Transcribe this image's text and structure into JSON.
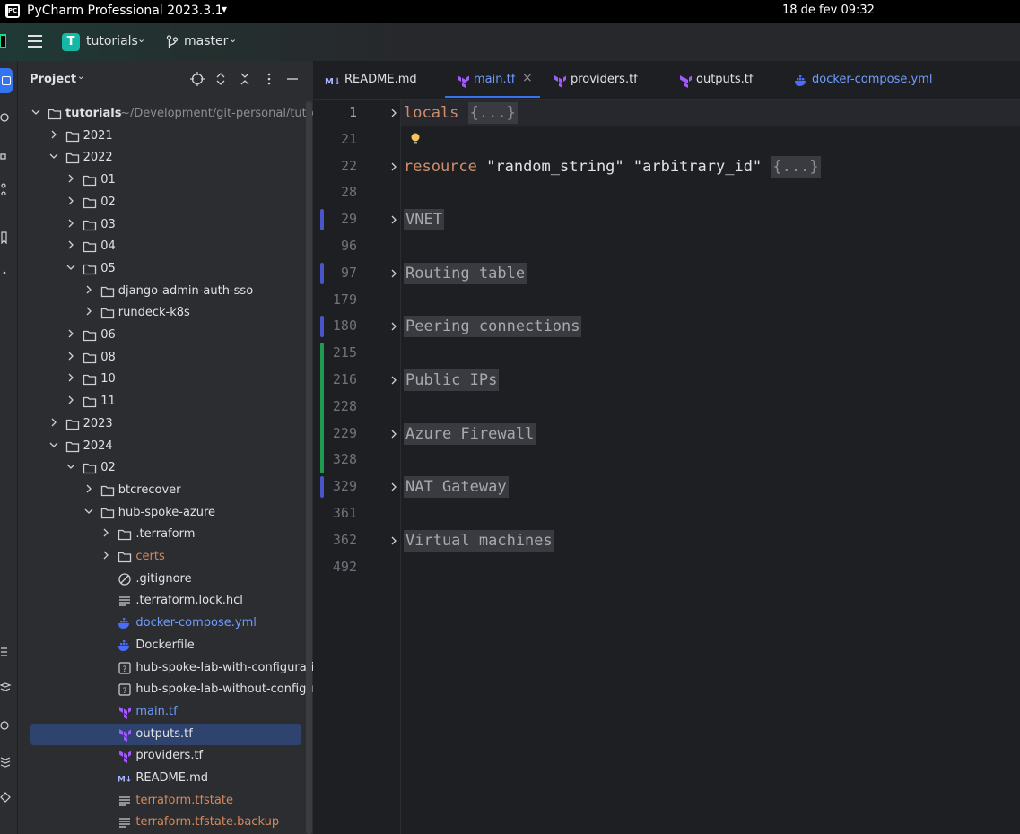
{
  "os_bar": {
    "app_name": "PyCharm Professional 2023.3.1",
    "caret": "▾",
    "date_time": "18 de fev  09:32"
  },
  "header": {
    "project_badge": "T",
    "project_name": "tutorials",
    "branch_name": "master",
    "caret": "⌄"
  },
  "panel": {
    "title": "Project",
    "title_caret": "⌄",
    "tools": [
      "crosshair-icon",
      "expand-icon",
      "collapse-icon",
      "more-icon",
      "minimize-icon"
    ],
    "tree": [
      {
        "label": "tutorials",
        "sub": "~/Development/git-personal/tutorials",
        "type": "folder",
        "depth": 0,
        "open": true,
        "bold": true
      },
      {
        "label": "2021",
        "type": "folder",
        "depth": 1,
        "open": false
      },
      {
        "label": "2022",
        "type": "folder",
        "depth": 1,
        "open": true
      },
      {
        "label": "01",
        "type": "folder",
        "depth": 2,
        "open": false
      },
      {
        "label": "02",
        "type": "folder",
        "depth": 2,
        "open": false
      },
      {
        "label": "03",
        "type": "folder",
        "depth": 2,
        "open": false
      },
      {
        "label": "04",
        "type": "folder",
        "depth": 2,
        "open": false
      },
      {
        "label": "05",
        "type": "folder",
        "depth": 2,
        "open": true
      },
      {
        "label": "django-admin-auth-sso",
        "type": "folder",
        "depth": 3,
        "open": false
      },
      {
        "label": "rundeck-k8s",
        "type": "folder",
        "depth": 3,
        "open": false
      },
      {
        "label": "06",
        "type": "folder",
        "depth": 2,
        "open": false
      },
      {
        "label": "08",
        "type": "folder",
        "depth": 2,
        "open": false
      },
      {
        "label": "10",
        "type": "folder",
        "depth": 2,
        "open": false
      },
      {
        "label": "11",
        "type": "folder",
        "depth": 2,
        "open": false
      },
      {
        "label": "2023",
        "type": "folder",
        "depth": 1,
        "open": false
      },
      {
        "label": "2024",
        "type": "folder",
        "depth": 1,
        "open": true
      },
      {
        "label": "02",
        "type": "folder",
        "depth": 2,
        "open": true
      },
      {
        "label": "btcrecover",
        "type": "folder",
        "depth": 3,
        "open": false
      },
      {
        "label": "hub-spoke-azure",
        "type": "folder",
        "depth": 3,
        "open": true
      },
      {
        "label": ".terraform",
        "type": "folder",
        "depth": 4,
        "open": false
      },
      {
        "label": "certs",
        "type": "folder",
        "depth": 4,
        "open": false,
        "color": "#d5895b"
      },
      {
        "label": ".gitignore",
        "type": "ignore",
        "depth": 4
      },
      {
        "label": ".terraform.lock.hcl",
        "type": "text",
        "depth": 4
      },
      {
        "label": "docker-compose.yml",
        "type": "docker",
        "depth": 4,
        "color": "#6f9cff"
      },
      {
        "label": "Dockerfile",
        "type": "docker",
        "depth": 4
      },
      {
        "label": "hub-spoke-lab-with-configuration",
        "type": "unknown",
        "depth": 4
      },
      {
        "label": "hub-spoke-lab-without-configuration",
        "type": "unknown",
        "depth": 4
      },
      {
        "label": "main.tf",
        "type": "terraform",
        "depth": 4,
        "color": "#6f9cff"
      },
      {
        "label": "outputs.tf",
        "type": "terraform",
        "depth": 4,
        "selected": true
      },
      {
        "label": "providers.tf",
        "type": "terraform",
        "depth": 4
      },
      {
        "label": "README.md",
        "type": "markdown",
        "depth": 4
      },
      {
        "label": "terraform.tfstate",
        "type": "text",
        "depth": 4,
        "color": "#d5895b"
      },
      {
        "label": "terraform.tfstate.backup",
        "type": "text",
        "depth": 4,
        "color": "#d5895b"
      }
    ]
  },
  "tabs": [
    {
      "label": "README.md",
      "icon": "markdown",
      "active": false,
      "color": "#dfe1e5"
    },
    {
      "label": "main.tf",
      "icon": "terraform",
      "active": true,
      "color": "#6f9cff",
      "close": "×"
    },
    {
      "label": "providers.tf",
      "icon": "terraform",
      "active": false,
      "color": "#dfe1e5"
    },
    {
      "label": "outputs.tf",
      "icon": "terraform",
      "active": false,
      "color": "#dfe1e5"
    },
    {
      "label": "docker-compose.yml",
      "icon": "docker",
      "active": false,
      "color": "#6f9cff"
    }
  ],
  "editor": {
    "lines": [
      {
        "num": "1",
        "fold": true,
        "parts": [
          {
            "t": "locals",
            "c": "kw"
          },
          {
            "t": " ",
            "c": ""
          },
          {
            "t": "{...}",
            "c": "fold-box"
          }
        ],
        "current": true
      },
      {
        "num": "21",
        "fold": false,
        "parts": []
      },
      {
        "num": "22",
        "fold": true,
        "parts": [
          {
            "t": "resource",
            "c": "kw"
          },
          {
            "t": " \"random_string\" \"arbitrary_id\" ",
            "c": "str"
          },
          {
            "t": "{...}",
            "c": "fold-box"
          }
        ]
      },
      {
        "num": "28",
        "fold": false,
        "parts": []
      },
      {
        "num": "29",
        "fold": true,
        "parts": [
          {
            "t": "VNET",
            "c": "region"
          }
        ],
        "vcs": "modified"
      },
      {
        "num": "96",
        "fold": false,
        "parts": []
      },
      {
        "num": "97",
        "fold": true,
        "parts": [
          {
            "t": "Routing table",
            "c": "region"
          }
        ],
        "vcs": "modified"
      },
      {
        "num": "179",
        "fold": false,
        "parts": []
      },
      {
        "num": "180",
        "fold": true,
        "parts": [
          {
            "t": "Peering connections",
            "c": "region"
          }
        ],
        "vcs": "modified"
      },
      {
        "num": "215",
        "fold": false,
        "parts": []
      },
      {
        "num": "216",
        "fold": true,
        "parts": [
          {
            "t": "Public IPs",
            "c": "region"
          }
        ]
      },
      {
        "num": "228",
        "fold": false,
        "parts": []
      },
      {
        "num": "229",
        "fold": true,
        "parts": [
          {
            "t": "Azure Firewall",
            "c": "region"
          }
        ]
      },
      {
        "num": "328",
        "fold": false,
        "parts": []
      },
      {
        "num": "329",
        "fold": true,
        "parts": [
          {
            "t": "NAT Gateway",
            "c": "region"
          }
        ],
        "vcs": "modified"
      },
      {
        "num": "361",
        "fold": false,
        "parts": []
      },
      {
        "num": "362",
        "fold": true,
        "parts": [
          {
            "t": "Virtual machines",
            "c": "region"
          }
        ]
      },
      {
        "num": "492",
        "fold": false,
        "parts": []
      }
    ]
  },
  "colors": {
    "accent": "#3574f0",
    "vcs_modified": "#4a55c9",
    "vcs_added": "#1f9b4f",
    "terraform": "#a259ff",
    "docker": "#4a6cf7"
  }
}
